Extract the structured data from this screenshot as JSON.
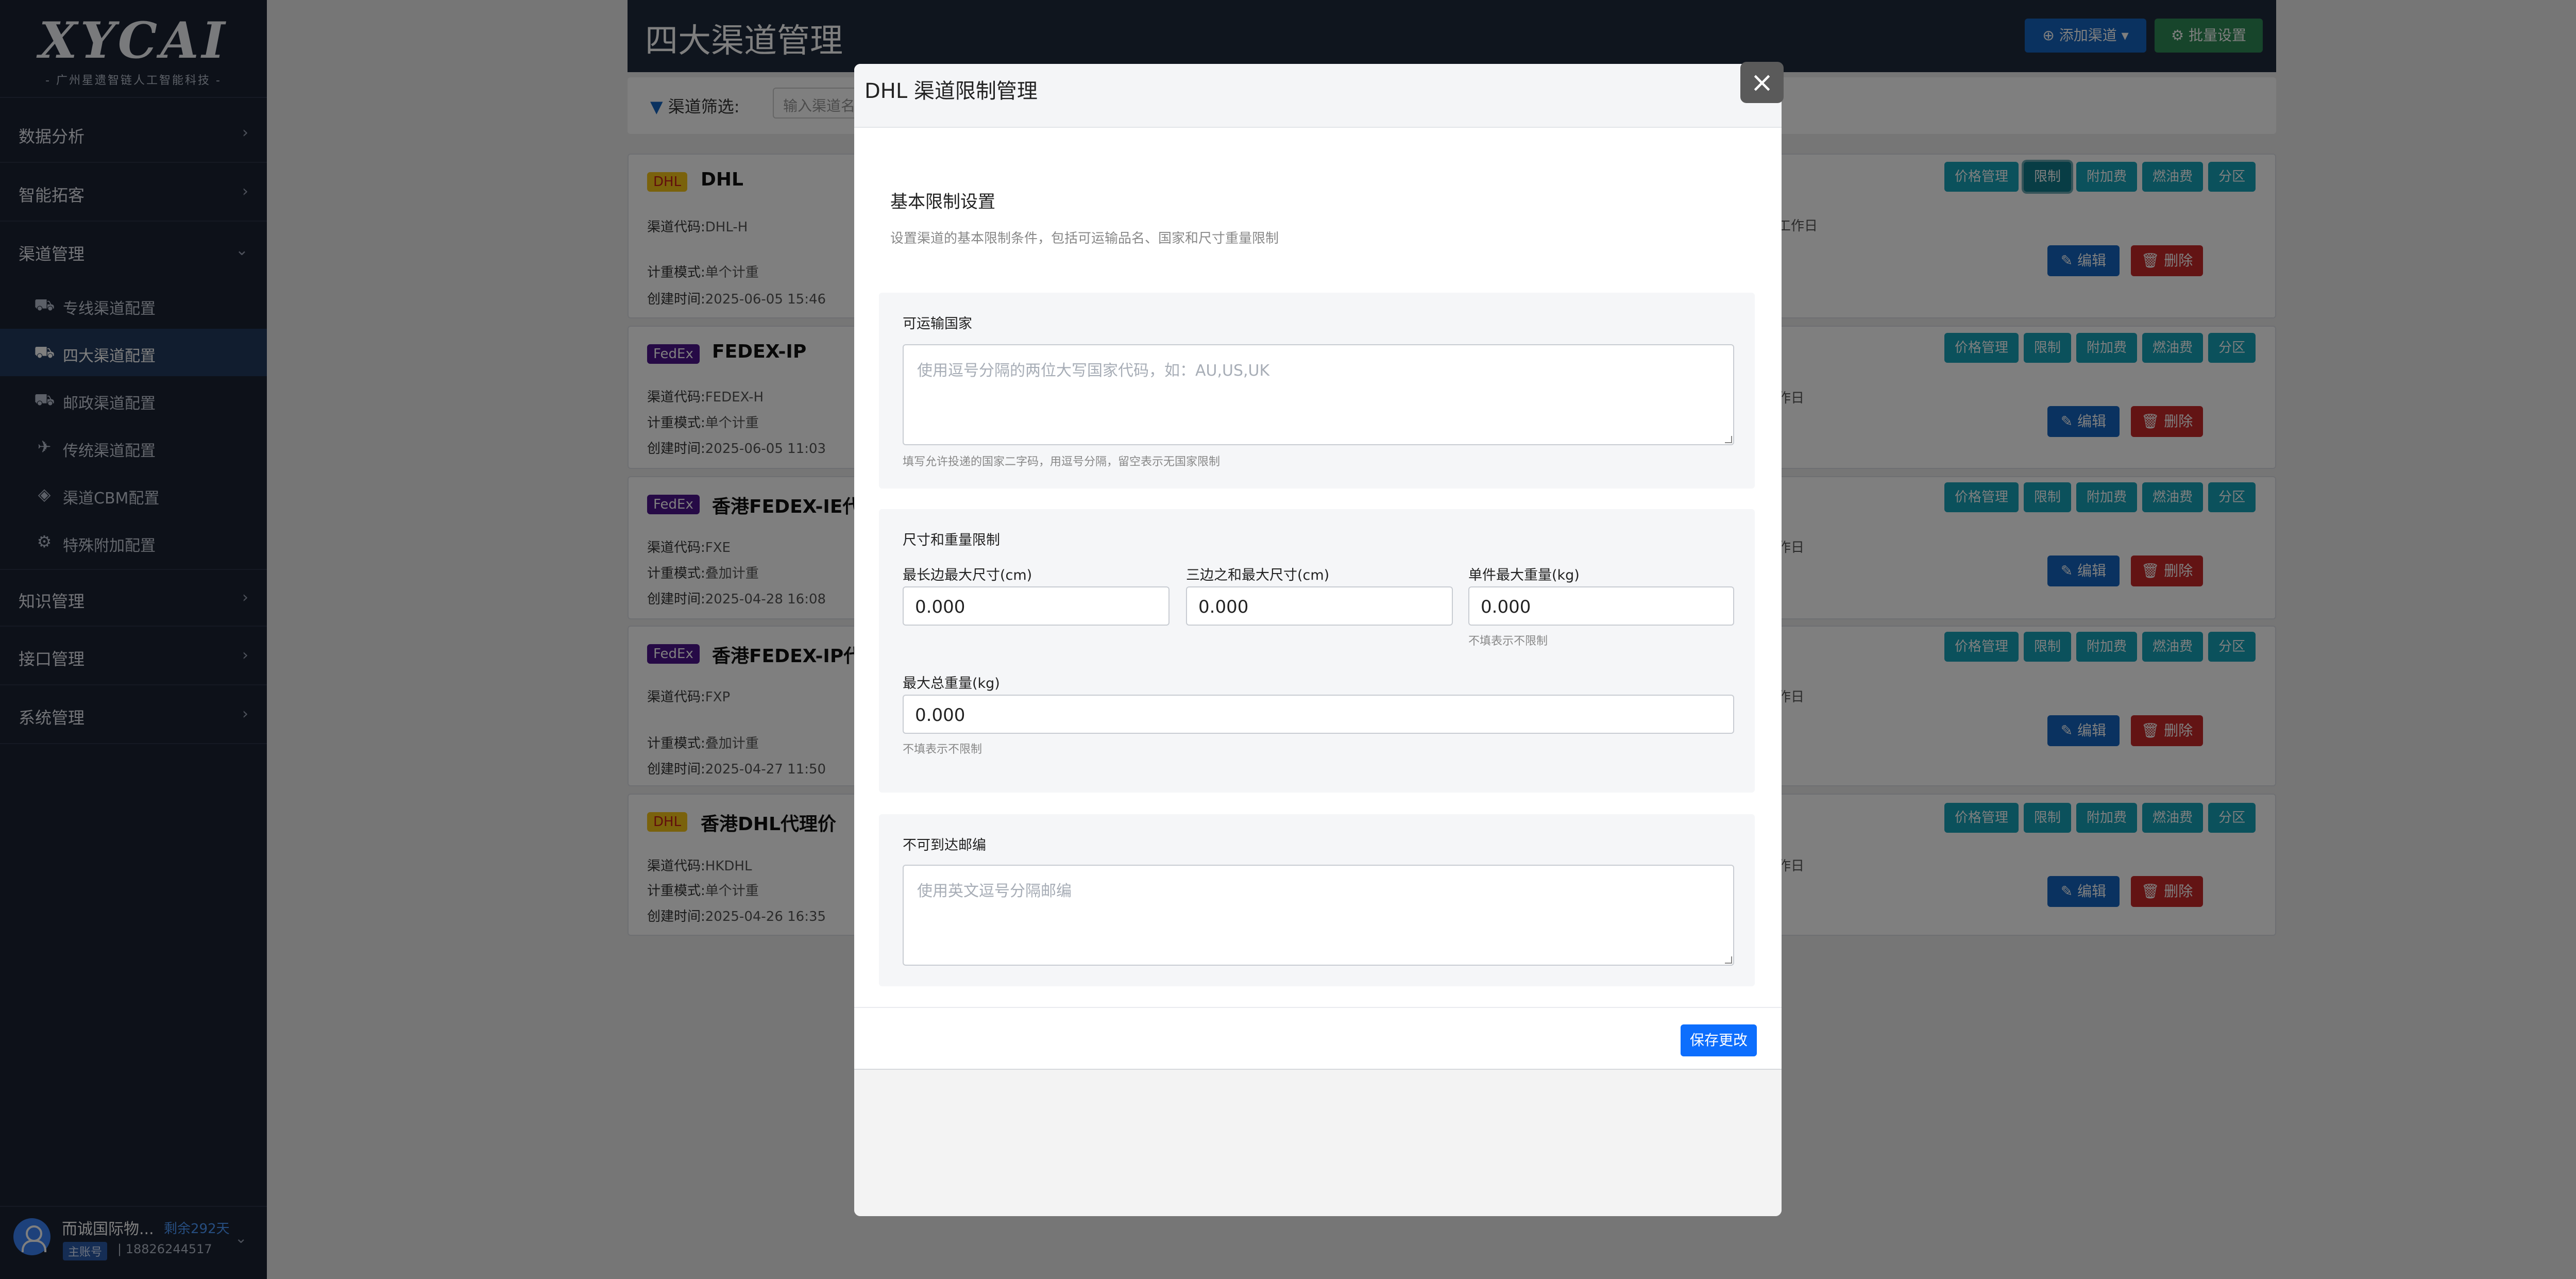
{
  "brand": {
    "logo": "XYCAI",
    "subtitle": "- 广州星遗智链人工智能科技 -"
  },
  "sidebar": {
    "sections": [
      {
        "label": "数据分析",
        "icon": "chevron-right-icon"
      },
      {
        "label": "智能拓客",
        "icon": "chevron-right-icon"
      },
      {
        "label": "渠道管理",
        "icon": "chevron-down-icon"
      },
      {
        "label": "知识管理",
        "icon": "chevron-right-icon"
      },
      {
        "label": "接口管理",
        "icon": "chevron-right-icon"
      },
      {
        "label": "系统管理",
        "icon": "chevron-right-icon"
      }
    ],
    "channel_items": [
      {
        "label": "专线渠道配置",
        "icon": "truck-icon"
      },
      {
        "label": "四大渠道配置",
        "icon": "truck-fast-icon",
        "active": true
      },
      {
        "label": "邮政渠道配置",
        "icon": "truck-icon"
      },
      {
        "label": "传统渠道配置",
        "icon": "plane-icon"
      },
      {
        "label": "渠道CBM配置",
        "icon": "cube-icon"
      },
      {
        "label": "特殊附加配置",
        "icon": "gear-icon"
      }
    ],
    "user": {
      "name": "而诚国际物...",
      "remaining": "剩余292天",
      "role": "主账号",
      "phone": "| 18826244517"
    }
  },
  "page": {
    "title": "四大渠道管理",
    "add_button": "添加渠道 ▾",
    "batch_button": "批量设置",
    "filter_label": "渠道筛选:",
    "filter_placeholder": "输入渠道名"
  },
  "card_buttons": [
    "价格管理",
    "限制",
    "附加费",
    "燃油费",
    "分区"
  ],
  "edit_label": "编辑",
  "delete_label": "删除",
  "field_labels": {
    "code": "渠道代码:",
    "mode": "计重模式:",
    "created": "创建时间:"
  },
  "cards": [
    {
      "badge": "DHL",
      "name": "DHL",
      "code": "DHL-H",
      "mode": "单个计重",
      "created": "2025-06-05 15:46",
      "right": "工作日"
    },
    {
      "badge": "FedEx",
      "name": "FEDEX-IP",
      "code": "FEDEX-H",
      "mode": "单个计重",
      "created": "2025-06-05 11:03",
      "right": "作日"
    },
    {
      "badge": "FedEx",
      "name": "香港FEDEX-IE代",
      "code": "FXE",
      "mode": "叠加计重",
      "created": "2025-04-28 16:08",
      "right": "作日"
    },
    {
      "badge": "FedEx",
      "name": "香港FEDEX-IP代",
      "code": "FXP",
      "mode": "叠加计重",
      "created": "2025-04-27 11:50",
      "right": "作日"
    },
    {
      "badge": "DHL",
      "name": "香港DHL代理价",
      "code": "HKDHL",
      "mode": "单个计重",
      "created": "2025-04-26 16:35",
      "right": "作日"
    }
  ],
  "modal": {
    "title": "DHL 渠道限制管理",
    "close_icon": "×",
    "section_title": "基本限制设置",
    "section_desc": "设置渠道的基本限制条件，包括可运输品名、国家和尺寸重量限制",
    "countries": {
      "label": "可运输国家",
      "placeholder": "使用逗号分隔的两位大写国家代码，如：AU,US,UK",
      "hint": "填写允许投递的国家二字码，用逗号分隔，留空表示无国家限制"
    },
    "size_weight": {
      "label": "尺寸和重量限制",
      "max_side_label": "最长边最大尺寸(cm)",
      "max_side_value": "0.000",
      "sum_sides_label": "三边之和最大尺寸(cm)",
      "sum_sides_value": "0.000",
      "max_piece_label": "单件最大重量(kg)",
      "max_piece_value": "0.000",
      "max_piece_hint": "不填表示不限制",
      "max_total_label": "最大总重量(kg)",
      "max_total_value": "0.000",
      "max_total_hint": "不填表示不限制"
    },
    "postcodes": {
      "label": "不可到达邮编",
      "placeholder": "使用英文逗号分隔邮编"
    },
    "save_button": "保存更改"
  }
}
